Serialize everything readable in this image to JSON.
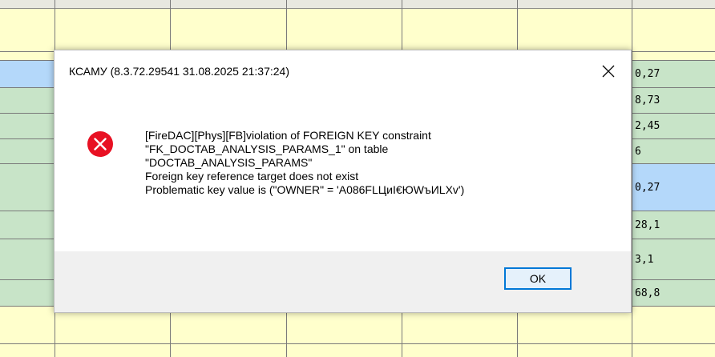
{
  "dialog": {
    "title": "КСАМУ (8.3.72.29541 31.08.2025 21:37:24)",
    "message_lines": [
      "[FireDAC][Phys][FB]violation of FOREIGN KEY constraint",
      "\"FK_DOCTAB_ANALYSIS_PARAMS_1\" on table",
      "\"DOCTAB_ANALYSIS_PARAMS\"",
      "Foreign key reference target does not exist",
      "Problematic key value is (\"OWNER\" = 'A086FLЦиI€ЮWъИLXv')"
    ],
    "ok_label": "OK",
    "close_icon": "close-icon",
    "status_icon": "error-icon"
  },
  "grid_values": [
    "0,27",
    "8,73",
    "2,45",
    "6",
    "0,27",
    "28,1",
    "3,1",
    "68,8"
  ],
  "colors": {
    "cell_yellow": "#ffffcc",
    "cell_green": "#c8e4c8",
    "cell_selected": "#b4d8fa",
    "accent": "#0078d7",
    "error_red": "#e81123"
  }
}
